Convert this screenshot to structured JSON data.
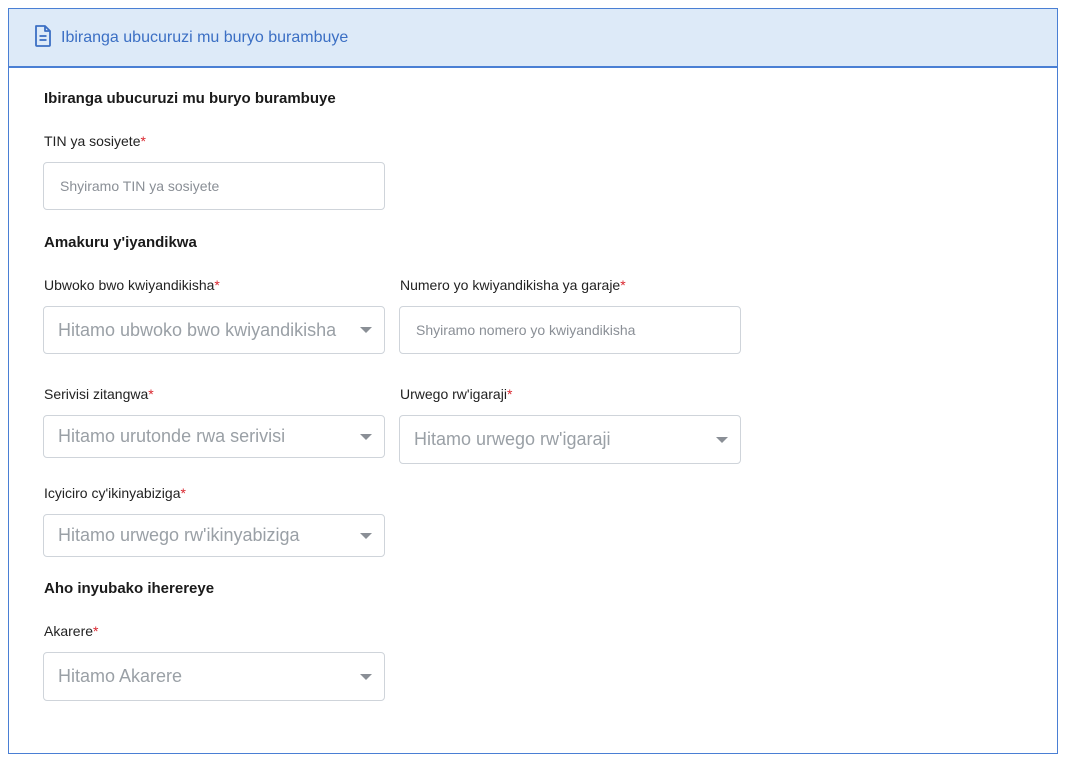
{
  "header": {
    "title": "Ibiranga ubucuruzi mu buryo burambuye",
    "icon": "document-icon"
  },
  "sections": {
    "details": "Ibiranga ubucuruzi mu buryo burambuye",
    "registration": "Amakuru y'iyandikwa",
    "location": "Aho inyubako iherereye"
  },
  "fields": {
    "tin": {
      "label": "TIN ya sosiyete",
      "required": "*",
      "placeholder": "Shyiramo TIN ya sosiyete"
    },
    "registration_type": {
      "label": "Ubwoko bwo kwiyandikisha",
      "required": "*",
      "placeholder": "Hitamo ubwoko bwo kwiyandikisha"
    },
    "garage_number": {
      "label": "Numero yo kwiyandikisha ya garaje",
      "required": "*",
      "placeholder": "Shyiramo nomero yo kwiyandikisha"
    },
    "services": {
      "label": "Serivisi zitangwa",
      "required": "*",
      "placeholder": "Hitamo urutonde rwa serivisi"
    },
    "garage_level": {
      "label": "Urwego rw'igaraji",
      "required": "*",
      "placeholder": "Hitamo urwego rw'igaraji"
    },
    "vehicle_category": {
      "label": "Icyiciro cy'ikinyabiziga",
      "required": "*",
      "placeholder": "Hitamo urwego rw'ikinyabiziga"
    },
    "district": {
      "label": "Akarere",
      "required": "*",
      "placeholder": "Hitamo Akarere"
    }
  },
  "colors": {
    "accent": "#3b6fc4",
    "header_bg": "#ddeaf8",
    "required": "#d9262e"
  }
}
